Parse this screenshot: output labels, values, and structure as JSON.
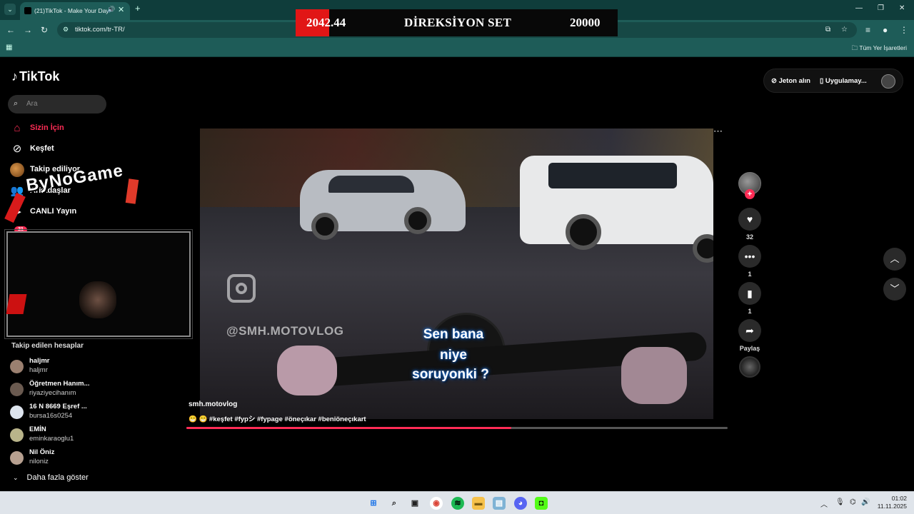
{
  "browser": {
    "tab_title": "(21)TikTok - Make Your Day",
    "url": "tiktok.com/tr-TR/",
    "bookmarks_all": "Tüm Yer İşaretleri"
  },
  "banner": {
    "value_left": "2042.44",
    "title": "DİREKSİYON SET",
    "value_right": "20000",
    "accent": "#e11616"
  },
  "sidebar": {
    "logo": "TikTok",
    "search_placeholder": "Ara",
    "nav": [
      {
        "label": "Sizin İçin",
        "icon": "home-icon",
        "active": true
      },
      {
        "label": "Keşfet",
        "icon": "compass-icon"
      },
      {
        "label": "Takip ediliyor",
        "icon": "avatar-icon"
      },
      {
        "label": "Arkadaşlar",
        "icon": "friends-icon"
      },
      {
        "label": "CANLI Yayın",
        "icon": "live-icon"
      }
    ],
    "notification_count": "21",
    "stream_overlay_text": "ByNoGame",
    "following_title": "Takip edilen hesaplar",
    "accounts": [
      {
        "name": "haljmr",
        "username": "haljmr"
      },
      {
        "name": "Öğretmen Hanım...",
        "username": "riyaziyecihanım"
      },
      {
        "name": "16 N 8669 Eşref ...",
        "username": "bursa16s0254"
      },
      {
        "name": "EMİN",
        "username": "eminkaraoglu1"
      },
      {
        "name": "Nil Öniz",
        "username": "niloniz"
      }
    ],
    "show_more": "Daha fazla göster"
  },
  "topbar": {
    "coins": "Jeton alın",
    "app": "Uygulamay..."
  },
  "video": {
    "watermark_handle": "@SMH.MOTOVLOG",
    "caption_lines": [
      "Sen bana",
      "niye",
      "soruyonki ?"
    ],
    "author": "smh.motovlog",
    "description": "😁 😁 #keşfet #fypシ #fypage #öneçıkar #beniöneçıkart",
    "progress": 0.6
  },
  "actions": {
    "likes": "32",
    "comments": "1",
    "saves": "1",
    "share_label": "Paylaş",
    "accent": "#fe2c55"
  },
  "taskbar": {
    "time": "01:02",
    "date": "11.11.2025"
  }
}
